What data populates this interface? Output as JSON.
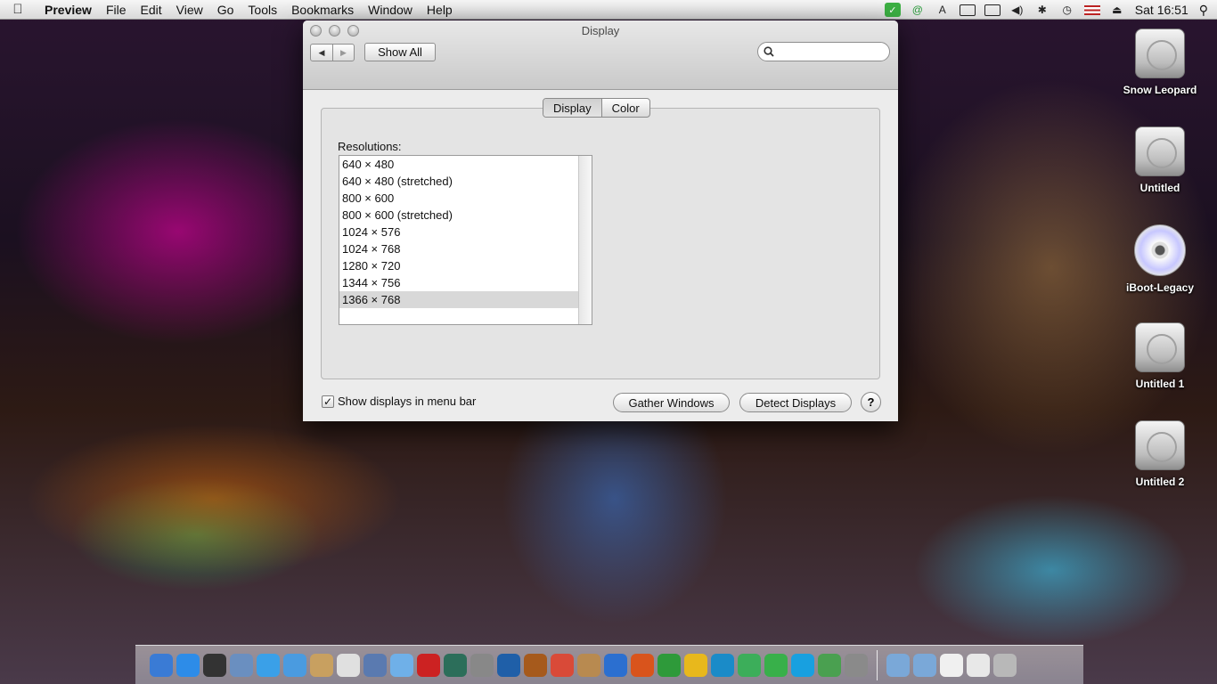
{
  "menubar": {
    "apple": "",
    "app_name": "Preview",
    "items": [
      "File",
      "Edit",
      "View",
      "Go",
      "Tools",
      "Bookmarks",
      "Window",
      "Help"
    ],
    "status_icons": [
      "evernote-icon",
      "adium-icon",
      "text-icon",
      "airplay-icon",
      "display-icon",
      "volume-icon",
      "bluetooth-icon",
      "time-machine-icon",
      "us-flag-icon",
      "eject-icon"
    ],
    "clock": "Sat 16:51",
    "spotlight": "⚲"
  },
  "window": {
    "title": "Display",
    "back": "◀",
    "forward": "▶",
    "show_all": "Show All",
    "search_placeholder": "",
    "tabs": [
      "Display",
      "Color"
    ],
    "active_tab": "Display",
    "resolutions_label": "Resolutions:",
    "resolutions": [
      "640 × 480",
      "640 × 480 (stretched)",
      "800 × 600",
      "800 × 600 (stretched)",
      "1024 × 576",
      "1024 × 768",
      "1280 × 720",
      "1344 × 756",
      "1366 × 768"
    ],
    "selected_resolution": "1366 × 768",
    "show_in_menubar_label": "Show displays in menu bar",
    "show_in_menubar_checked": true,
    "checkmark": "✓",
    "gather_windows": "Gather Windows",
    "detect_displays": "Detect Displays",
    "help": "?"
  },
  "desktop": {
    "icons": [
      {
        "label": "Snow Leopard",
        "kind": "drive"
      },
      {
        "label": "Untitled",
        "kind": "drive"
      },
      {
        "label": "iBoot-Legacy",
        "kind": "disc"
      },
      {
        "label": "Untitled 1",
        "kind": "drive"
      },
      {
        "label": "Untitled 2",
        "kind": "drive"
      }
    ]
  },
  "dock": {
    "apps": [
      {
        "name": "finder-icon",
        "color": "#3a7bd5"
      },
      {
        "name": "app-store-icon",
        "color": "#2d8ce8"
      },
      {
        "name": "dashboard-icon",
        "color": "#333333"
      },
      {
        "name": "preview-icon",
        "color": "#6a8fc0"
      },
      {
        "name": "safari-icon",
        "color": "#3aa0e8"
      },
      {
        "name": "ichat-icon",
        "color": "#4a9be0"
      },
      {
        "name": "address-book-icon",
        "color": "#c8a060"
      },
      {
        "name": "ical-icon",
        "color": "#e0e0e0"
      },
      {
        "name": "iphoto-icon",
        "color": "#5a7ab0"
      },
      {
        "name": "itunes-icon",
        "color": "#6fb0e8"
      },
      {
        "name": "photo-booth-icon",
        "color": "#cc2222"
      },
      {
        "name": "time-machine-icon",
        "color": "#2c6e5a"
      },
      {
        "name": "system-preferences-icon",
        "color": "#888888"
      },
      {
        "name": "photoshop-icon",
        "color": "#1f5fa8"
      },
      {
        "name": "bridge-icon",
        "color": "#a65a1c"
      },
      {
        "name": "chrome-icon",
        "color": "#d94a38"
      },
      {
        "name": "archive-utility-icon",
        "color": "#b88a50"
      },
      {
        "name": "word-icon",
        "color": "#2b6fd0"
      },
      {
        "name": "powerpoint-icon",
        "color": "#d9541c"
      },
      {
        "name": "excel-icon",
        "color": "#2e9a3a"
      },
      {
        "name": "outlook-icon",
        "color": "#e8b81c"
      },
      {
        "name": "c-app-icon",
        "color": "#1a8bc8"
      },
      {
        "name": "messenger-icon",
        "color": "#3cae5a"
      },
      {
        "name": "adium-icon",
        "color": "#38b04a"
      },
      {
        "name": "skype-icon",
        "color": "#18a0e0"
      },
      {
        "name": "network-icon",
        "color": "#4aa050"
      },
      {
        "name": "parallels-icon",
        "color": "#8a8a8a"
      }
    ],
    "stacks": [
      {
        "name": "applications-folder-icon",
        "color": "#7aa8d8"
      },
      {
        "name": "documents-folder-icon",
        "color": "#7aa8d8"
      },
      {
        "name": "document-icon",
        "color": "#f0f0f0"
      },
      {
        "name": "downloads-icon",
        "color": "#e8e8e8"
      },
      {
        "name": "trash-icon",
        "color": "#b8b8b8"
      }
    ]
  }
}
